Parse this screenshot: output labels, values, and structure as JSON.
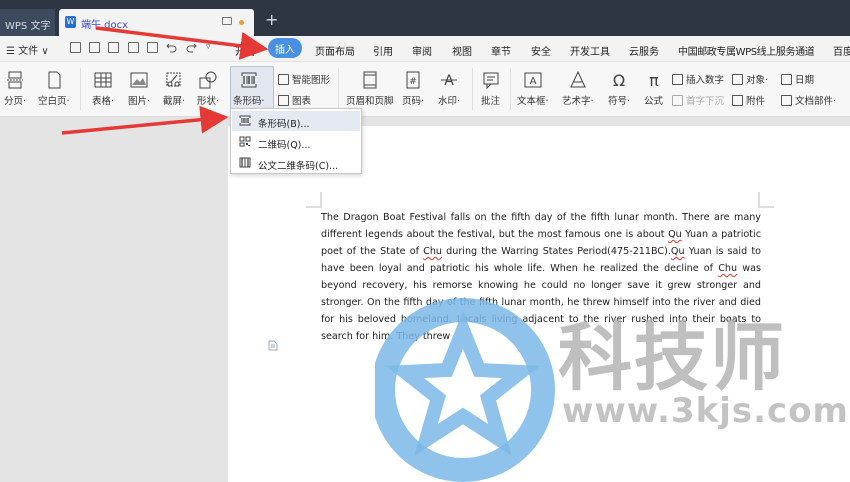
{
  "titlebar": {
    "app_tab": "WPS 文字",
    "doc_tab": "端午.docx",
    "new_tab": "+"
  },
  "menubar": {
    "file": "☰ 文件 ∨",
    "tabs": [
      "开始",
      "插入",
      "页面布局",
      "引用",
      "审阅",
      "视图",
      "章节",
      "安全",
      "开发工具",
      "云服务",
      "中国邮政专属WPS线上服务通道",
      "百度"
    ],
    "active_tab": "插入"
  },
  "ribbon": {
    "page_break": "分页·",
    "blank_page": "空白页·",
    "table": "表格·",
    "picture": "图片·",
    "screenshot": "截屏·",
    "shape": "形状·",
    "barcode": "条形码·",
    "smart_graphic": "智能图形",
    "chart": "图表",
    "header_footer": "页眉和页脚",
    "page_number": "页码·",
    "watermark": "水印·",
    "comment": "批注",
    "textbox": "文本框·",
    "wordart": "艺术字·",
    "symbol": "符号·",
    "formula": "公式",
    "insert_number": "插入数字",
    "object": "对象·",
    "date": "日期",
    "drop_cap": "首字下沉",
    "attachment": "附件",
    "doc_parts": "文档部件·"
  },
  "dropdown": {
    "items": [
      "条形码(B)...",
      "二维码(Q)...",
      "公文二维条码(C)..."
    ]
  },
  "document": {
    "p1": "The Dragon Boat Festival falls on the fifth day of the fifth lunar month. There are many different legends about the festival, but the most famous one is about ",
    "qu1": "Qu",
    "p2": " Yuan a patriotic poet of the State of ",
    "chu1": "Chu",
    "p3": " during the Warring States Period(475-211BC).",
    "qu2": "Qu",
    "p4": " Yuan is said to have been loyal and patriotic his whole life. When he realized the decline of ",
    "chu2": "Chu",
    "p5": " was beyond recovery, his remorse knowing he could no longer save it grew stronger and stronger. On the fifth day of the fifth lunar month, he threw himself into the river and died for his beloved homeland. Locals living adjacent to the river rushed into their boats to search for him. They threw"
  },
  "watermark": {
    "brand": "科技师",
    "url": "www.3kjs.com"
  },
  "colors": {
    "titlebar": "#2e3643",
    "accent": "#4a90e2",
    "arrow": "#e53935",
    "watermark_logo": "#7bb8e8"
  }
}
